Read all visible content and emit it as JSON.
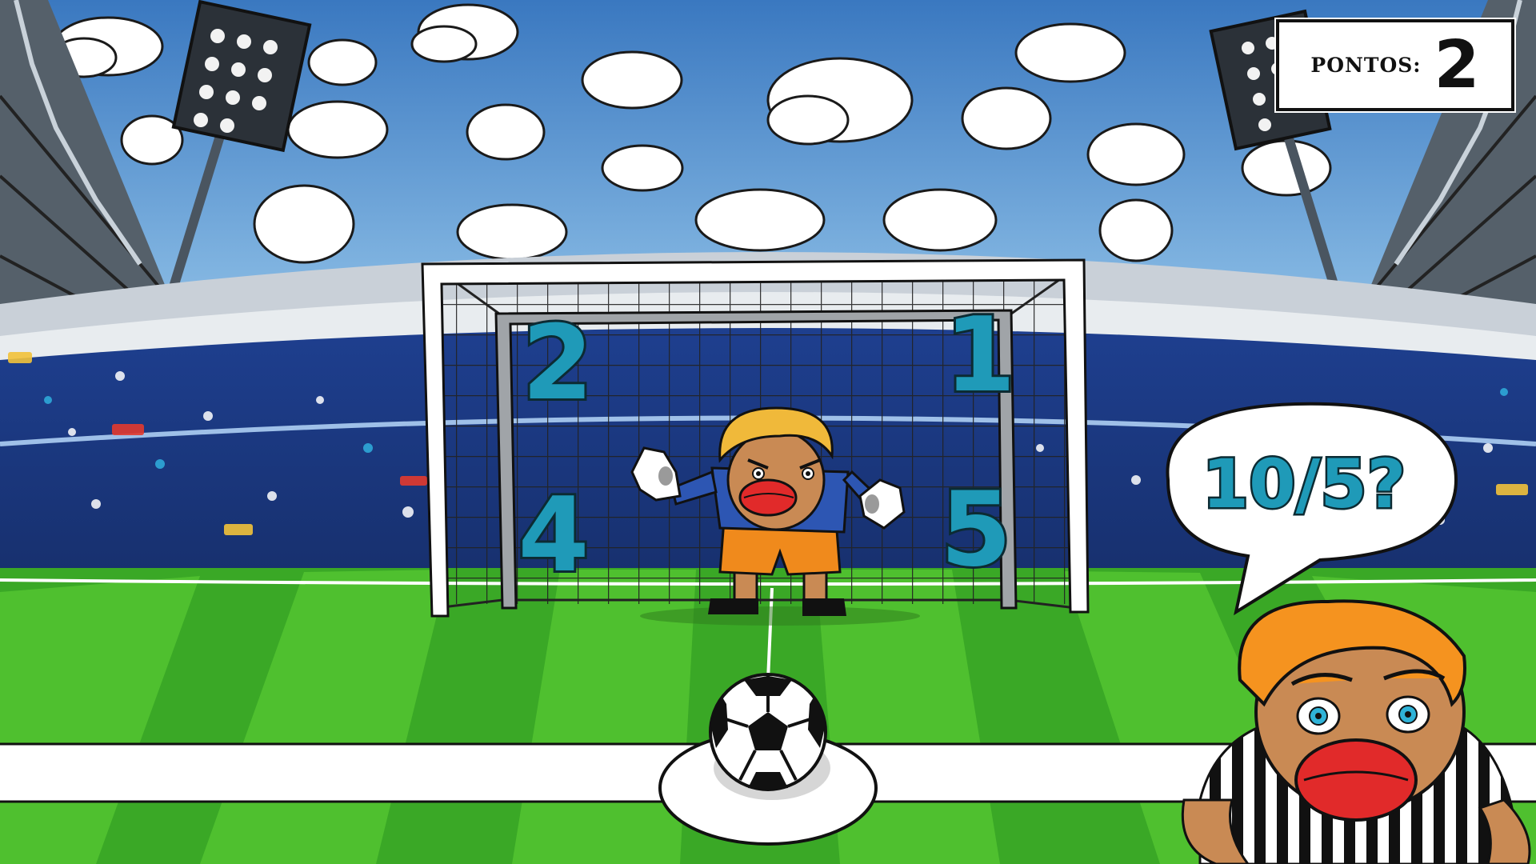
{
  "hud": {
    "score_label": "PONTOS:",
    "score_value": "2"
  },
  "question": {
    "text": "10/5?"
  },
  "goal_targets": [
    {
      "id": "top-left",
      "label": "2"
    },
    {
      "id": "top-right",
      "label": "1"
    },
    {
      "id": "bottom-left",
      "label": "4"
    },
    {
      "id": "bottom-right",
      "label": "5"
    }
  ],
  "colors": {
    "sky": "#3f7fc0",
    "grass_light": "#4fc02f",
    "grass_dark": "#2e9a1c",
    "number_fill": "#1f9ab8",
    "number_stroke": "#0c2b33",
    "keeper_shirt": "#2d56b3",
    "keeper_shorts": "#f08a1c",
    "keeper_hair": "#f0b93a",
    "striker_hair": "#f5931f"
  },
  "icons": [
    "soccer-ball-icon",
    "stadium-floodlight-icon",
    "cloud-icon",
    "speech-bubble-icon"
  ]
}
